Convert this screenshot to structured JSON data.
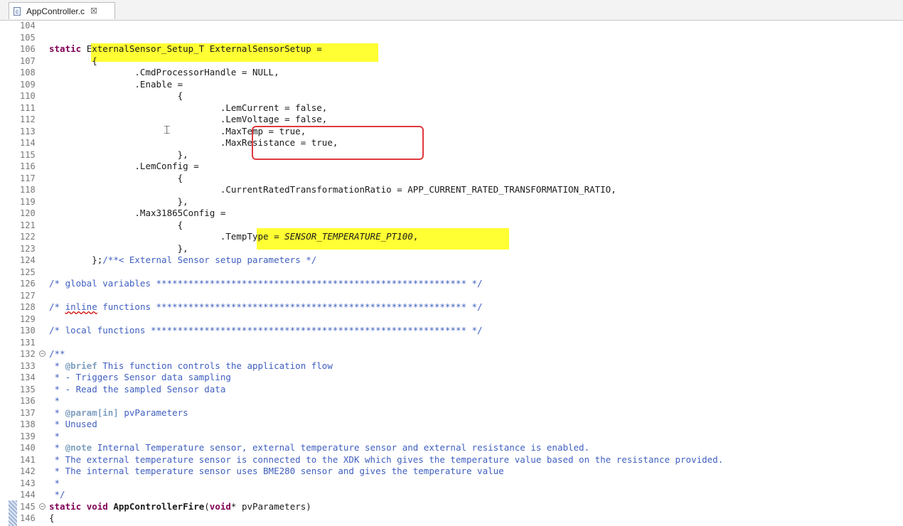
{
  "tab": {
    "title": "AppController.c",
    "close": "☒",
    "icon_letter": "c"
  },
  "highlight_color": "#ffff33",
  "annotation_color": "#e0393e",
  "lines": [
    {
      "n": "104",
      "segs": []
    },
    {
      "n": "105",
      "segs": []
    },
    {
      "n": "106",
      "segs": [
        {
          "t": "static ",
          "c": "kw"
        },
        {
          "t": "ExternalSensor_Setup_T ExternalSensorSetup",
          "c": ""
        },
        {
          "t": " =",
          "c": ""
        }
      ]
    },
    {
      "n": "107",
      "segs": [
        {
          "t": "        {",
          "c": ""
        }
      ]
    },
    {
      "n": "108",
      "segs": [
        {
          "t": "                .CmdProcessorHandle = NULL,",
          "c": ""
        }
      ]
    },
    {
      "n": "109",
      "segs": [
        {
          "t": "                .Enable =",
          "c": ""
        }
      ]
    },
    {
      "n": "110",
      "segs": [
        {
          "t": "                        {",
          "c": ""
        }
      ]
    },
    {
      "n": "111",
      "segs": [
        {
          "t": "                                .LemCurrent = false,",
          "c": ""
        }
      ]
    },
    {
      "n": "112",
      "segs": [
        {
          "t": "                                .LemVoltage = false,",
          "c": ""
        }
      ]
    },
    {
      "n": "113",
      "segs": [
        {
          "t": "                                .MaxTemp = true,",
          "c": ""
        }
      ]
    },
    {
      "n": "114",
      "segs": [
        {
          "t": "                                .MaxResistance = true,",
          "c": ""
        }
      ]
    },
    {
      "n": "115",
      "segs": [
        {
          "t": "                        },",
          "c": ""
        }
      ]
    },
    {
      "n": "116",
      "segs": [
        {
          "t": "                .LemConfig =",
          "c": ""
        }
      ]
    },
    {
      "n": "117",
      "segs": [
        {
          "t": "                        {",
          "c": ""
        }
      ]
    },
    {
      "n": "118",
      "segs": [
        {
          "t": "                                .CurrentRatedTransformationRatio = APP_CURRENT_RATED_TRANSFORMATION_RATIO,",
          "c": ""
        }
      ]
    },
    {
      "n": "119",
      "segs": [
        {
          "t": "                        },",
          "c": ""
        }
      ]
    },
    {
      "n": "120",
      "segs": [
        {
          "t": "                .Max31865Config =",
          "c": ""
        }
      ]
    },
    {
      "n": "121",
      "segs": [
        {
          "t": "                        {",
          "c": ""
        }
      ]
    },
    {
      "n": "122",
      "segs": [
        {
          "t": "                                .TempType = ",
          "c": ""
        },
        {
          "t": "SENSOR_TEMPERATURE_PT100",
          "c": "it"
        },
        {
          "t": ",",
          "c": ""
        }
      ]
    },
    {
      "n": "123",
      "segs": [
        {
          "t": "                        },",
          "c": ""
        }
      ]
    },
    {
      "n": "124",
      "segs": [
        {
          "t": "        };",
          "c": ""
        },
        {
          "t": "/**< External Sensor setup parameters */",
          "c": "cm"
        }
      ]
    },
    {
      "n": "125",
      "segs": []
    },
    {
      "n": "126",
      "segs": [
        {
          "t": "/* global variables ********************************************************** */",
          "c": "cm"
        }
      ]
    },
    {
      "n": "127",
      "segs": []
    },
    {
      "n": "128",
      "segs": [
        {
          "t": "/* ",
          "c": "cm"
        },
        {
          "t": "inline",
          "c": "cm squig"
        },
        {
          "t": " functions ********************************************************** */",
          "c": "cm"
        }
      ]
    },
    {
      "n": "129",
      "segs": []
    },
    {
      "n": "130",
      "segs": [
        {
          "t": "/* local functions *********************************************************** */",
          "c": "cm"
        }
      ]
    },
    {
      "n": "131",
      "segs": []
    },
    {
      "n": "132",
      "fold": true,
      "segs": [
        {
          "t": "/**",
          "c": "cm"
        }
      ]
    },
    {
      "n": "133",
      "segs": [
        {
          "t": " * ",
          "c": "cm"
        },
        {
          "t": "@brief",
          "c": "tag"
        },
        {
          "t": " This function controls the application flow",
          "c": "cm"
        }
      ]
    },
    {
      "n": "134",
      "segs": [
        {
          "t": " * - Triggers Sensor data sampling",
          "c": "cm"
        }
      ]
    },
    {
      "n": "135",
      "segs": [
        {
          "t": " * - Read the sampled Sensor data",
          "c": "cm"
        }
      ]
    },
    {
      "n": "136",
      "segs": [
        {
          "t": " *",
          "c": "cm"
        }
      ]
    },
    {
      "n": "137",
      "segs": [
        {
          "t": " * ",
          "c": "cm"
        },
        {
          "t": "@param[in]",
          "c": "tag"
        },
        {
          "t": " pvParameters",
          "c": "cm"
        }
      ]
    },
    {
      "n": "138",
      "segs": [
        {
          "t": " * Unused",
          "c": "cm"
        }
      ]
    },
    {
      "n": "139",
      "segs": [
        {
          "t": " *",
          "c": "cm"
        }
      ]
    },
    {
      "n": "140",
      "segs": [
        {
          "t": " * ",
          "c": "cm"
        },
        {
          "t": "@note",
          "c": "tag"
        },
        {
          "t": " Internal Temperature sensor, external temperature sensor and external resistance is enabled.",
          "c": "cm"
        }
      ]
    },
    {
      "n": "141",
      "segs": [
        {
          "t": " * The external temperature sensor is connected to the XDK which gives the temperature value based on the resistance provided.",
          "c": "cm"
        }
      ]
    },
    {
      "n": "142",
      "segs": [
        {
          "t": " * The internal temperature sensor uses BME280 sensor and gives the temperature value",
          "c": "cm"
        }
      ]
    },
    {
      "n": "143",
      "segs": [
        {
          "t": " *",
          "c": "cm"
        }
      ]
    },
    {
      "n": "144",
      "segs": [
        {
          "t": " */",
          "c": "cm"
        }
      ]
    },
    {
      "n": "145",
      "fold": true,
      "segs": [
        {
          "t": "static ",
          "c": "kw"
        },
        {
          "t": "void ",
          "c": "kw"
        },
        {
          "t": "AppControllerFire",
          "c": "b"
        },
        {
          "t": "(",
          "c": ""
        },
        {
          "t": "void",
          "c": "kw"
        },
        {
          "t": "* pvParameters)",
          "c": ""
        }
      ]
    },
    {
      "n": "146",
      "segs": [
        {
          "t": "{",
          "c": ""
        }
      ]
    }
  ]
}
